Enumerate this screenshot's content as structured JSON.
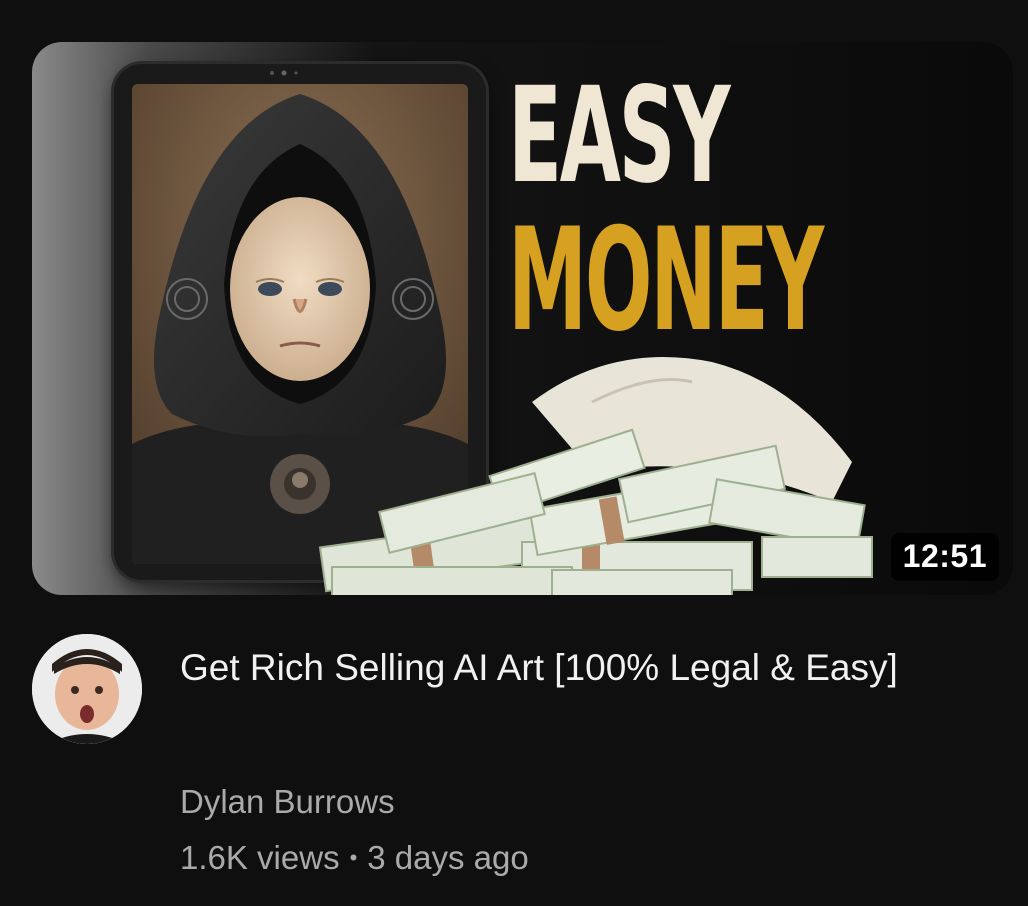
{
  "thumbnail": {
    "headline_line1": "EASY",
    "headline_line2": "MONEY",
    "duration": "12:51",
    "colors": {
      "headline_line1": "#efe6d4",
      "headline_line2": "#d6a020",
      "background": "#0b0b0b"
    }
  },
  "video": {
    "title": "Get Rich Selling AI Art [100% Legal & Easy]",
    "channel": "Dylan Burrows",
    "views": "1.6K views",
    "separator": "•",
    "age": "3 days ago"
  },
  "icons": {
    "avatar": "channel-avatar"
  }
}
